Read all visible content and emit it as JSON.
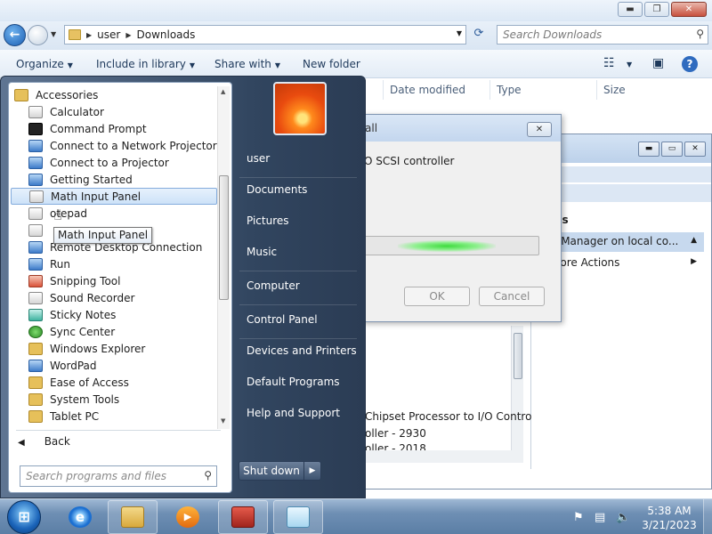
{
  "explorer": {
    "breadcrumb": [
      "user",
      "Downloads"
    ],
    "search_placeholder": "Search Downloads",
    "toolbar": {
      "organize": "Organize",
      "include_in_library": "Include in library",
      "share_with": "Share with",
      "new_folder": "New folder"
    },
    "columns": {
      "date_modified": "Date modified",
      "type": "Type",
      "size": "Size"
    },
    "caption": {
      "minimize": "▬",
      "restore": "❐",
      "close": "✕"
    }
  },
  "device_manager": {
    "actions_header": "ns",
    "actions_selected": "e Manager on local co...",
    "more_actions": "More Actions",
    "tree": [
      "Chipset Processor to I/O Contro",
      "oller - 2930",
      "oller - 2018"
    ]
  },
  "dialog": {
    "title": "all",
    "text": "O SCSI controller",
    "ok": "OK",
    "cancel": "Cancel",
    "close": "✕",
    "progress_state": "indeterminate"
  },
  "start_menu": {
    "programs": [
      {
        "label": "Accessories",
        "icon": "folder-icon"
      },
      {
        "label": "Calculator",
        "icon": "calculator-icon"
      },
      {
        "label": "Command Prompt",
        "icon": "command-prompt-icon"
      },
      {
        "label": "Connect to a Network Projector",
        "icon": "network-projector-icon"
      },
      {
        "label": "Connect to a Projector",
        "icon": "projector-icon"
      },
      {
        "label": "Getting Started",
        "icon": "getting-started-icon"
      },
      {
        "label": "Math Input Panel",
        "icon": "math-input-icon"
      },
      {
        "label": "otepad",
        "icon": "notepad-icon"
      },
      {
        "label": "",
        "icon": "paint-icon"
      },
      {
        "label": "Remote Desktop Connection",
        "icon": "remote-desktop-icon"
      },
      {
        "label": "Run",
        "icon": "run-icon"
      },
      {
        "label": "Snipping Tool",
        "icon": "snipping-tool-icon"
      },
      {
        "label": "Sound Recorder",
        "icon": "sound-recorder-icon"
      },
      {
        "label": "Sticky Notes",
        "icon": "sticky-notes-icon"
      },
      {
        "label": "Sync Center",
        "icon": "sync-center-icon"
      },
      {
        "label": "Windows Explorer",
        "icon": "windows-explorer-icon"
      },
      {
        "label": "WordPad",
        "icon": "wordpad-icon"
      },
      {
        "label": "Ease of Access",
        "icon": "folder-icon"
      },
      {
        "label": "System Tools",
        "icon": "folder-icon"
      },
      {
        "label": "Tablet PC",
        "icon": "folder-icon"
      }
    ],
    "highlighted_index": 6,
    "tooltip": "Math Input Panel",
    "back": "Back",
    "search_placeholder": "Search programs and files",
    "right_items": [
      "user",
      "Documents",
      "Pictures",
      "Music",
      "Computer",
      "Control Panel",
      "Devices and Printers",
      "Default Programs",
      "Help and Support"
    ],
    "shutdown": "Shut down"
  },
  "taskbar": {
    "time": "5:38 AM",
    "date": "3/21/2023",
    "apps": [
      "internet-explorer-icon",
      "windows-explorer-icon",
      "media-player-icon",
      "toolbox-icon",
      "notepad-icon"
    ]
  }
}
